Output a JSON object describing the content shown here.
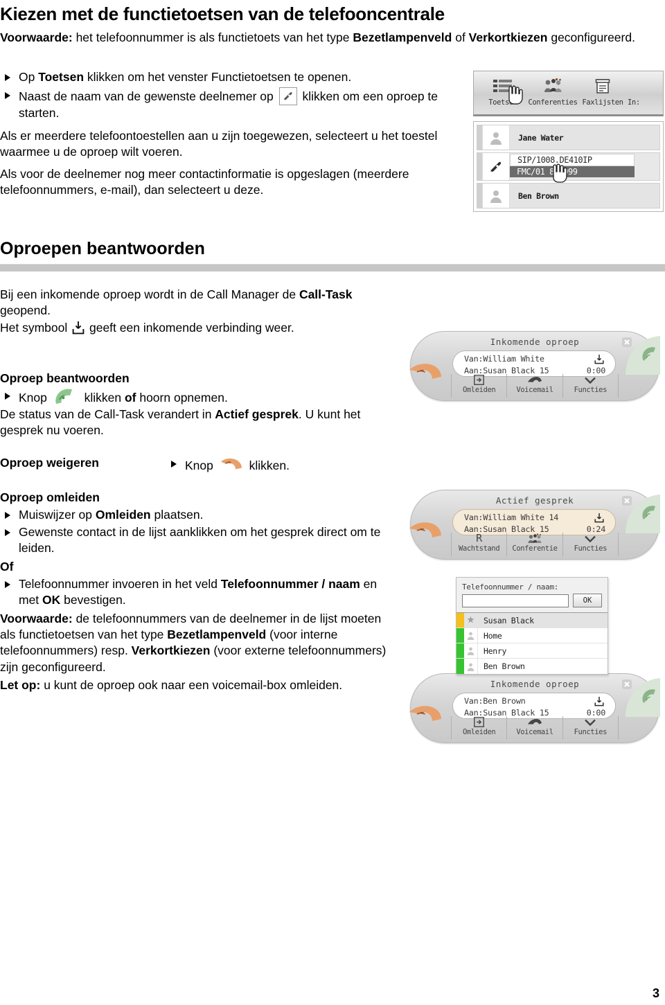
{
  "document": {
    "title": "Kiezen met de functietoetsen van de telefooncentrale",
    "page_number": "3"
  },
  "intro": {
    "condition_label": "Voorwaarde:",
    "condition_text_1": " het telefoonnummer is als functietoets van het type ",
    "condition_bold_1": "Bezetlampenveld",
    "condition_text_2": " of ",
    "condition_bold_2": "Verkortkiezen",
    "condition_text_3": " geconfigureerd.",
    "bullets": [
      {
        "pre": "Op ",
        "bold": "Toetsen",
        "post": " klikken om het venster Functietoetsen te openen."
      },
      {
        "pre": "Naast de naam van de gewenste deelnemer op ",
        "post": " klikken om een oproep te starten."
      }
    ],
    "para_1": "Als er meerdere telefoontoestellen aan u zijn toegewezen, selecteert u het toestel waarmee u de oproep wilt voeren.",
    "para_2": "Als voor de deelnemer nog meer contactinformatie is opgeslagen (meerdere telefoonnummers, e-mail), dan selecteert u deze."
  },
  "toolbar_shot": {
    "items": [
      {
        "label": "Toetsen",
        "icon": "list-icon"
      },
      {
        "label": "Conferenties",
        "icon": "people-group-icon"
      },
      {
        "label": "Faxlijsten",
        "icon": "document-icon"
      },
      {
        "label": "In:",
        "icon": "cut-off-icon"
      }
    ]
  },
  "contact_shot": {
    "rows": [
      {
        "name": "Jane Water",
        "type": "contact"
      },
      {
        "name": "",
        "type": "dropdown"
      },
      {
        "name": "Ben Brown",
        "type": "contact"
      }
    ],
    "dropdown": {
      "option_1": "SIP/1008.DE410IP",
      "option_2": "FMC/01  888999"
    }
  },
  "section_answer": {
    "heading": "Oproepen beantwoorden",
    "intro_1_pre": "Bij een inkomende oproep wordt in de Call Manager de ",
    "intro_1_bold": "Call-Task",
    "intro_1_post": " geopend.",
    "intro_2_pre": "Het symbool ",
    "intro_2_post": " geeft een inkomende verbinding weer."
  },
  "sub_answer": {
    "heading": "Oproep beantwoorden",
    "bullet_pre": "Knop ",
    "bullet_mid": " klikken ",
    "bullet_bold": "of",
    "bullet_post": " hoorn opnemen.",
    "para_pre": "De status van de Call-Task verandert in ",
    "para_bold": "Actief gesprek",
    "para_post": ". U kunt het gesprek nu voeren."
  },
  "sub_reject": {
    "heading": "Oproep weigeren",
    "bullet_pre": "Knop ",
    "bullet_post": " klikken."
  },
  "sub_forward": {
    "heading": "Oproep omleiden",
    "bullets": [
      {
        "pre": "Muiswijzer op ",
        "bold": "Omleiden",
        "post": " plaatsen."
      },
      {
        "pre": "Gewenste contact in de lijst aanklikken om het gesprek direct om te leiden.",
        "bold": "",
        "post": ""
      }
    ],
    "or_label": "Of",
    "or_bullet_pre": "Telefoonnummer invoeren in het veld ",
    "or_bullet_bold_1": "Telefoonnummer / naam",
    "or_bullet_mid": " en met ",
    "or_bullet_bold_2": "OK",
    "or_bullet_post": " bevestigen.",
    "condition_label": "Voorwaarde:",
    "condition_1": " de telefoonnummers van de deelnemer in de lijst moeten als functietoetsen van het type ",
    "condition_bold_1": "Bezetlampenveld",
    "condition_2": " (voor interne telefoonnummers) resp. ",
    "condition_bold_2": "Verkortkiezen",
    "condition_3": " (voor externe telefoonnummers) zijn geconfigureerd.",
    "note_label": "Let op:",
    "note_text": " u kunt de oproep ook naar een voicemail-box omleiden."
  },
  "calltask_incoming": {
    "title": "Inkomende oproep",
    "from_label": "Van:William White",
    "to_label": "Aan:Susan Black 15",
    "duration": "0:00",
    "buttons": [
      {
        "label": "Omleiden",
        "icon": "forward-arrow-icon"
      },
      {
        "label": "Voicemail",
        "icon": "handset-down-icon"
      },
      {
        "label": "Functies",
        "icon": "chevron-down-icon"
      }
    ]
  },
  "calltask_active": {
    "title": "Actief gesprek",
    "from_label": "Van:William White 14",
    "to_label": "Aan:Susan Black 15",
    "duration": "0:24",
    "buttons": [
      {
        "label": "Wachtstand",
        "icon": "letter-r-icon"
      },
      {
        "label": "Conferentie",
        "icon": "people-group-icon"
      },
      {
        "label": "Functies",
        "icon": "chevron-down-icon"
      }
    ]
  },
  "calltask_forward": {
    "title": "Inkomende oproep",
    "from_label": "Van:Ben Brown",
    "to_label": "Aan:Susan Black 15",
    "duration": "0:00",
    "buttons": [
      {
        "label": "Omleiden",
        "icon": "forward-arrow-icon"
      },
      {
        "label": "Voicemail",
        "icon": "handset-down-icon"
      },
      {
        "label": "Functies",
        "icon": "chevron-down-icon"
      }
    ]
  },
  "number_entry": {
    "label": "Telefoonnummer / naam:",
    "value": "",
    "ok_label": "OK",
    "items": [
      {
        "name": "Susan Black",
        "status_color": "#f5bf1c",
        "icon": "star-icon",
        "highlighted": true
      },
      {
        "name": "Home",
        "status_color": "#36c431",
        "icon": "person-icon",
        "highlighted": false
      },
      {
        "name": "Henry",
        "status_color": "#36c431",
        "icon": "person-icon",
        "highlighted": false
      },
      {
        "name": "Ben Brown",
        "status_color": "#36c431",
        "icon": "person-icon",
        "highlighted": false
      }
    ]
  },
  "colors": {
    "accept_green": "#8cc68c",
    "reject_orange": "#e8a06a",
    "rule_gray": "#c6c6c6",
    "active_panel": "#f6ead9"
  }
}
